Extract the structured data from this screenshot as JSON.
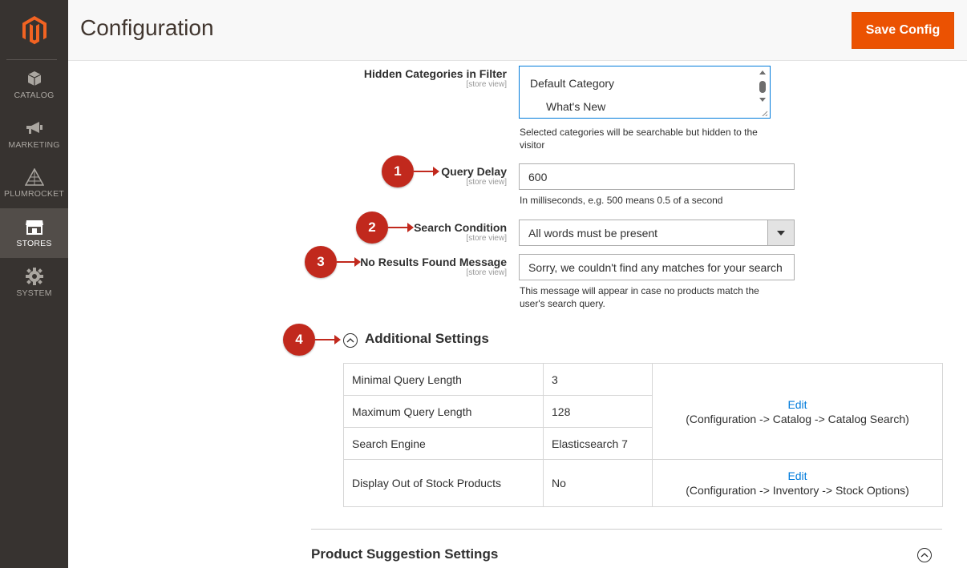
{
  "app": {
    "title": "Configuration",
    "save_label": "Save Config",
    "accent_color": "#eb5202"
  },
  "sidebar": {
    "items": [
      {
        "label": "CATALOG",
        "icon": "cube-icon"
      },
      {
        "label": "MARKETING",
        "icon": "megaphone-icon"
      },
      {
        "label": "PLUMROCKET",
        "icon": "pyramid-icon"
      },
      {
        "label": "STORES",
        "icon": "store-icon",
        "active": true
      },
      {
        "label": "SYSTEM",
        "icon": "gear-icon"
      }
    ]
  },
  "form": {
    "hidden_categories": {
      "label": "Hidden Categories in Filter",
      "scope": "[store view]",
      "options": [
        "Default Category",
        "What's New"
      ],
      "note": "Selected categories will be searchable but hidden to the visitor"
    },
    "query_delay": {
      "label": "Query Delay",
      "scope": "[store view]",
      "value": "600",
      "note": "In milliseconds, e.g. 500 means 0.5 of a second"
    },
    "search_condition": {
      "label": "Search Condition",
      "scope": "[store view]",
      "value": "All words must be present"
    },
    "no_results": {
      "label": "No Results Found Message",
      "scope": "[store view]",
      "value": "Sorry, we couldn't find any matches for your search",
      "note": "This message will appear in case no products match the user's search query."
    }
  },
  "callouts": [
    "1",
    "2",
    "3",
    "4"
  ],
  "additional_settings": {
    "title": "Additional Settings",
    "rows": [
      {
        "name": "Minimal Query Length",
        "value": "3"
      },
      {
        "name": "Maximum Query Length",
        "value": "128"
      },
      {
        "name": "Search Engine",
        "value": "Elasticsearch 7"
      },
      {
        "name": "Display Out of Stock Products",
        "value": "No"
      }
    ],
    "edit_label": "Edit",
    "catalog_path": "(Configuration -> Catalog -> Catalog Search)",
    "inventory_path": "(Configuration -> Inventory -> Stock Options)"
  },
  "product_suggestion": {
    "title": "Product Suggestion Settings"
  }
}
